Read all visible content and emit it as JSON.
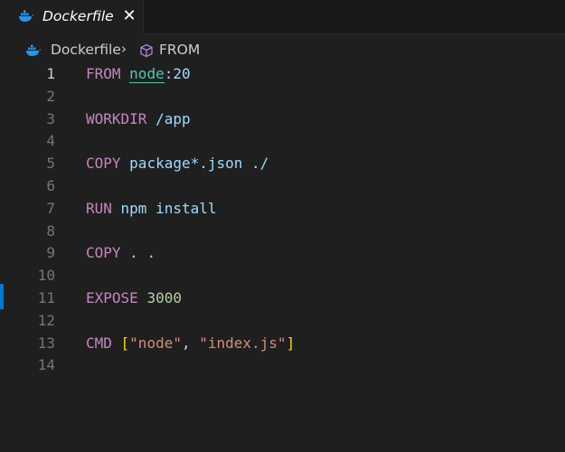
{
  "tab": {
    "title": "Dockerfile",
    "close_glyph": "✕",
    "icon": "docker-whale-icon",
    "icon_color": "#2496ed"
  },
  "breadcrumb": {
    "file": "Dockerfile",
    "separator": "›",
    "symbol": "FROM",
    "symbol_icon": "cube-icon",
    "symbol_icon_color": "#b180d7"
  },
  "editor": {
    "active_line": 1,
    "lines": [
      {
        "num": "1",
        "tokens": [
          {
            "t": "FROM ",
            "c": "kw"
          },
          {
            "t": "node",
            "c": "node-under"
          },
          {
            "t": ":20",
            "c": "ident"
          }
        ]
      },
      {
        "num": "2",
        "tokens": []
      },
      {
        "num": "3",
        "tokens": [
          {
            "t": "WORKDIR ",
            "c": "kw"
          },
          {
            "t": "/app",
            "c": "ident"
          }
        ]
      },
      {
        "num": "4",
        "tokens": []
      },
      {
        "num": "5",
        "tokens": [
          {
            "t": "COPY ",
            "c": "kw"
          },
          {
            "t": "package*.json ./",
            "c": "ident"
          }
        ]
      },
      {
        "num": "6",
        "tokens": []
      },
      {
        "num": "7",
        "tokens": [
          {
            "t": "RUN ",
            "c": "kw"
          },
          {
            "t": "npm install",
            "c": "ident"
          }
        ]
      },
      {
        "num": "8",
        "tokens": []
      },
      {
        "num": "9",
        "tokens": [
          {
            "t": "COPY ",
            "c": "kw"
          },
          {
            "t": ". .",
            "c": "ident"
          }
        ]
      },
      {
        "num": "10",
        "tokens": []
      },
      {
        "num": "11",
        "tokens": [
          {
            "t": "EXPOSE ",
            "c": "kw"
          },
          {
            "t": "3000",
            "c": "num"
          }
        ]
      },
      {
        "num": "12",
        "tokens": []
      },
      {
        "num": "13",
        "tokens": [
          {
            "t": "CMD ",
            "c": "kw"
          },
          {
            "t": "[",
            "c": "brk"
          },
          {
            "t": "\"node\"",
            "c": "str"
          },
          {
            "t": ", ",
            "c": "plain"
          },
          {
            "t": "\"index.js\"",
            "c": "str"
          },
          {
            "t": "]",
            "c": "brk"
          }
        ]
      },
      {
        "num": "14",
        "tokens": []
      }
    ]
  }
}
